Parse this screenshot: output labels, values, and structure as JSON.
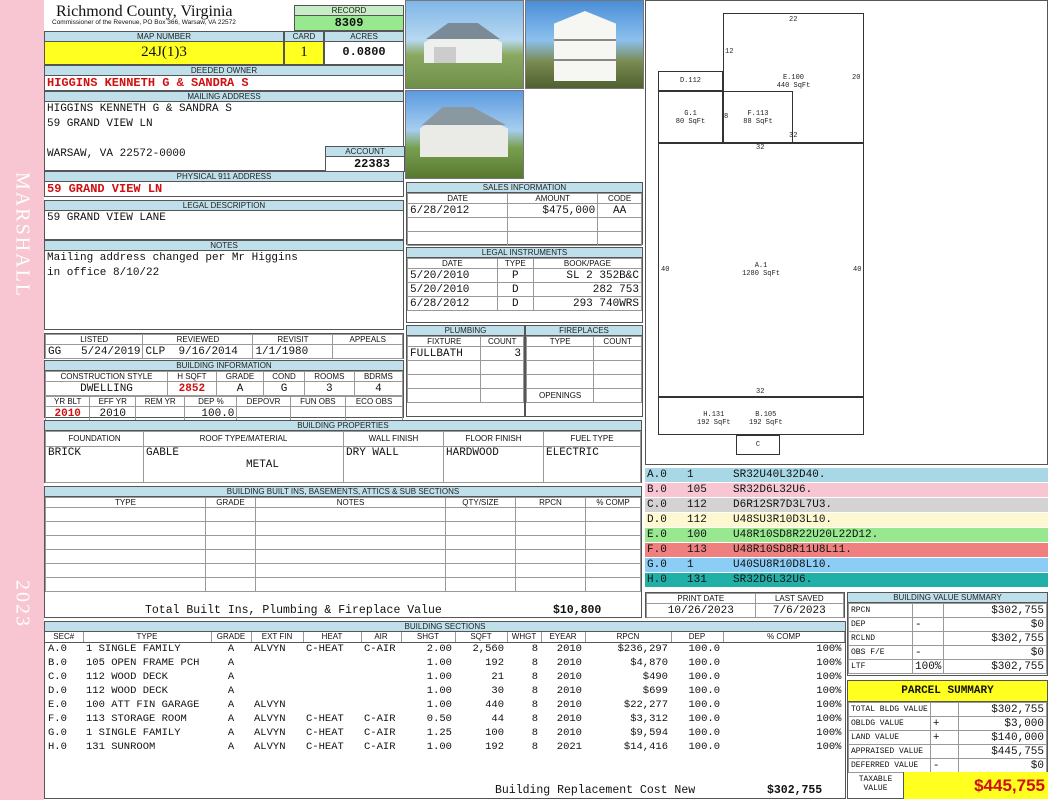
{
  "sidebar": {
    "top": "MARSHALL",
    "bottom": "2023"
  },
  "header": {
    "county": "Richmond County, Virginia",
    "commissioner": "Commissioner of the Revenue, PO Box 366, Warsaw, VA 22572",
    "record_label": "RECORD",
    "record": "8309",
    "map_label": "MAP NUMBER",
    "map_number": "24J(1)3",
    "card_label": "CARD",
    "card": "1",
    "acres_label": "ACRES",
    "acres": "0.0800"
  },
  "owner": {
    "deeded_label": "DEEDED OWNER",
    "deeded": "HIGGINS KENNETH G & SANDRA S",
    "mailing_label": "MAILING ADDRESS",
    "line1": "HIGGINS KENNETH G & SANDRA S",
    "line2": "59 GRAND VIEW LN",
    "line3": "WARSAW, VA 22572-0000",
    "account_label": "ACCOUNT",
    "account": "22383",
    "physical_label": "PHYSICAL 911 ADDRESS",
    "physical": "59 GRAND VIEW LN",
    "legal_label": "LEGAL DESCRIPTION",
    "legal": "59 GRAND VIEW LANE",
    "notes_label": "NOTES",
    "notes1": "Mailing address changed per Mr Higgins",
    "notes2": "in office 8/10/22"
  },
  "sales": {
    "title": "SALES INFORMATION",
    "cols": [
      "DATE",
      "AMOUNT",
      "CODE"
    ],
    "rows": [
      [
        "6/28/2012",
        "$475,000",
        "AA"
      ]
    ]
  },
  "legal_instruments": {
    "title": "LEGAL INSTRUMENTS",
    "cols": [
      "DATE",
      "TYPE",
      "BOOK/PAGE"
    ],
    "rows": [
      [
        "5/20/2010",
        "P",
        "SL 2 352B&C"
      ],
      [
        "5/20/2010",
        "D",
        "282 753"
      ],
      [
        "6/28/2012",
        "D",
        "293 740WRS"
      ]
    ]
  },
  "review": {
    "cols": [
      "LISTED",
      "REVIEWED",
      "REVISIT",
      "APPEALS"
    ],
    "listed_by": "GG",
    "listed": "5/24/2019",
    "reviewed_by": "CLP",
    "reviewed": "9/16/2014",
    "revisit": "1/1/1980",
    "appeals": ""
  },
  "building_info": {
    "title": "BUILDING INFORMATION",
    "cols": [
      "CONSTRUCTION STYLE",
      "H SQFT",
      "GRADE",
      "COND",
      "ROOMS",
      "BDRMS"
    ],
    "vals": [
      "DWELLING",
      "2852",
      "A",
      "G",
      "3",
      "4"
    ],
    "cols2": [
      "YR BLT",
      "EFF YR",
      "REM YR",
      "DEP %",
      "DEPOVR",
      "FUN OBS",
      "ECO OBS"
    ],
    "vals2": [
      "2010",
      "2010",
      "",
      "100.0",
      "",
      "",
      ""
    ]
  },
  "plumbing": {
    "title": "PLUMBING",
    "cols": [
      "FIXTURE",
      "COUNT"
    ],
    "rows": [
      [
        "FULLBATH",
        "3"
      ]
    ]
  },
  "fireplaces": {
    "title": "FIREPLACES",
    "cols": [
      "TYPE",
      "COUNT"
    ],
    "openings": "OPENINGS"
  },
  "props": {
    "title": "BUILDING PROPERTIES",
    "cols": [
      "FOUNDATION",
      "ROOF TYPE/MATERIAL",
      "WALL FINISH",
      "FLOOR FINISH",
      "FUEL TYPE"
    ],
    "foundation": "BRICK",
    "roof1": "GABLE",
    "roof2": "METAL",
    "wall": "DRY WALL",
    "floor": "HARDWOOD",
    "fuel": "ELECTRIC"
  },
  "builtins": {
    "title": "BUILDING BUILT INS, BASEMENTS, ATTICS & SUB SECTIONS",
    "cols": [
      "TYPE",
      "GRADE",
      "NOTES",
      "QTY/SIZE",
      "RPCN",
      "% COMP"
    ],
    "total_label": "Total Built Ins, Plumbing & Fireplace Value",
    "total": "$10,800"
  },
  "sections": {
    "title": "BUILDING SECTIONS",
    "cols": [
      "SEC#",
      "TYPE",
      "GRADE",
      "EXT FIN",
      "HEAT",
      "AIR",
      "SHGT",
      "SQFT",
      "WHGT",
      "EYEAR",
      "RPCN",
      "DEP",
      "% COMP"
    ],
    "rows": [
      [
        "A.0",
        "1 SINGLE FAMILY",
        "A",
        "ALVYN",
        "C-HEAT",
        "C-AIR",
        "2.00",
        "2,560",
        "8",
        "2010",
        "$236,297",
        "100.0",
        "100%"
      ],
      [
        "B.0",
        "105 OPEN FRAME PCH",
        "A",
        "",
        "",
        "",
        "1.00",
        "192",
        "8",
        "2010",
        "$4,870",
        "100.0",
        "100%"
      ],
      [
        "C.0",
        "112 WOOD DECK",
        "A",
        "",
        "",
        "",
        "1.00",
        "21",
        "8",
        "2010",
        "$490",
        "100.0",
        "100%"
      ],
      [
        "D.0",
        "112 WOOD DECK",
        "A",
        "",
        "",
        "",
        "1.00",
        "30",
        "8",
        "2010",
        "$699",
        "100.0",
        "100%"
      ],
      [
        "E.0",
        "100 ATT FIN GARAGE",
        "A",
        "ALVYN",
        "",
        "",
        "1.00",
        "440",
        "8",
        "2010",
        "$22,277",
        "100.0",
        "100%"
      ],
      [
        "F.0",
        "113 STORAGE ROOM",
        "A",
        "ALVYN",
        "C-HEAT",
        "C-AIR",
        "0.50",
        "44",
        "8",
        "2010",
        "$3,312",
        "100.0",
        "100%"
      ],
      [
        "G.0",
        "1 SINGLE FAMILY",
        "A",
        "ALVYN",
        "C-HEAT",
        "C-AIR",
        "1.25",
        "100",
        "8",
        "2010",
        "$9,594",
        "100.0",
        "100%"
      ],
      [
        "H.0",
        "131 SUNROOM",
        "A",
        "ALVYN",
        "C-HEAT",
        "C-AIR",
        "1.00",
        "192",
        "8",
        "2021",
        "$14,416",
        "100.0",
        "100%"
      ]
    ],
    "total_label": "Building Replacement Cost New",
    "total": "$302,755"
  },
  "sketch": {
    "rooms": [
      {
        "id": "E",
        "label": "E.100",
        "area": "440 SqFt",
        "color": "#98e890"
      },
      {
        "id": "D",
        "label": "D.112",
        "area": "",
        "color": "#fdf8d0"
      },
      {
        "id": "G",
        "label": "G.1",
        "area": "80 SqFt",
        "color": "#8ccdf5"
      },
      {
        "id": "F",
        "label": "F.113",
        "area": "88 SqFt",
        "color": "#f08080"
      },
      {
        "id": "A",
        "label": "A.1",
        "area": "1280 SqFt",
        "color": "#a8d8e6"
      },
      {
        "id": "H",
        "label": "H.131",
        "area": "192 SqFt",
        "color": "#20b0a8"
      },
      {
        "id": "B",
        "label": "B.105",
        "area": "192 SqFt",
        "color": "#20b0a8"
      },
      {
        "id": "C",
        "label": "C",
        "area": "",
        "color": "#d0d0d0"
      }
    ],
    "dims": [
      "22",
      "12",
      "20",
      "8",
      "32",
      "32",
      "40",
      "40",
      "32"
    ]
  },
  "segments": [
    {
      "id": "A.0",
      "code": "1",
      "path": "SR32U40L32D40.",
      "color": "#a8d8e6"
    },
    {
      "id": "B.0",
      "code": "105",
      "path": "SR32D6L32U6.",
      "color": "#f7c6d2"
    },
    {
      "id": "C.0",
      "code": "112",
      "path": "D6R12SR7D3L7U3.",
      "color": "#d3d3d3"
    },
    {
      "id": "D.0",
      "code": "112",
      "path": "U48SU3R10D3L10.",
      "color": "#fdf8d0"
    },
    {
      "id": "E.0",
      "code": "100",
      "path": "U48R10SD8R22U20L22D12.",
      "color": "#98e890"
    },
    {
      "id": "F.0",
      "code": "113",
      "path": "U48R10SD8R11U8L11.",
      "color": "#f08080"
    },
    {
      "id": "G.0",
      "code": "1",
      "path": "U40SU8R10D8L10.",
      "color": "#8ccdf5"
    },
    {
      "id": "H.0",
      "code": "131",
      "path": "SR32D6L32U6.",
      "color": "#20b0a8"
    }
  ],
  "dates": {
    "print_label": "PRINT DATE",
    "print": "10/26/2023",
    "saved_label": "LAST SAVED",
    "saved": "7/6/2023"
  },
  "bvs": {
    "title": "BUILDING VALUE SUMMARY",
    "rows": [
      [
        "RPCN",
        "",
        "$302,755"
      ],
      [
        "DEP",
        "-",
        "$0"
      ],
      [
        "RCLND",
        "",
        "$302,755"
      ],
      [
        "OBS F/E",
        "-",
        "$0"
      ],
      [
        "LTF",
        "100%",
        "$302,755"
      ]
    ]
  },
  "parcel": {
    "title": "PARCEL SUMMARY",
    "rows": [
      [
        "TOTAL BLDG VALUE",
        "",
        "$302,755"
      ],
      [
        "OBLDG VALUE",
        "+",
        "$3,000"
      ],
      [
        "LAND VALUE",
        "+",
        "$140,000"
      ],
      [
        "APPRAISED VALUE",
        "",
        "$445,755"
      ],
      [
        "DEFERRED VALUE",
        "-",
        "$0"
      ]
    ],
    "taxable_label": "TAXABLE VALUE",
    "taxable": "$445,755"
  }
}
